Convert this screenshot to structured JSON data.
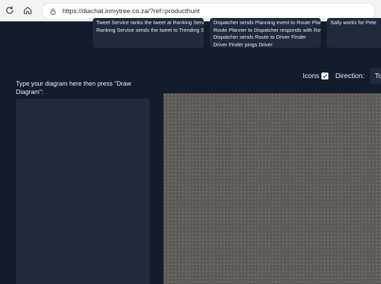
{
  "browser": {
    "url": "https://diachat.inmytree.co.za/?ref=producthunt",
    "reload_icon": "reload-icon",
    "home_icon": "home-icon",
    "lock_icon": "lock-icon"
  },
  "examples": [
    {
      "lines": [
        "Tweet Service ranks the tweet at Ranking Service",
        "Ranking Service sends the tweet to Trending Service"
      ]
    },
    {
      "lines": [
        "Dispatcher sends Planning event to Route Planner",
        "Route Planner to Dispatcher responds with Route E",
        "Dispatcher sends Route to Driver Finder",
        "Driver Finder pings Driver"
      ]
    },
    {
      "lines": [
        "Sally works for Pete"
      ]
    }
  ],
  "editor": {
    "instructions": "Type your diagram here then press \"Draw Diagram\":",
    "value": "",
    "placeholder": ""
  },
  "options": {
    "icons_label": "Icons",
    "icons_checked": true,
    "direction_label": "Direction:",
    "direction_value": "To"
  },
  "colors": {
    "page_bg": "#131c2b",
    "card_bg": "#1f2b3d",
    "canvas_bg": "#5d5a57"
  }
}
